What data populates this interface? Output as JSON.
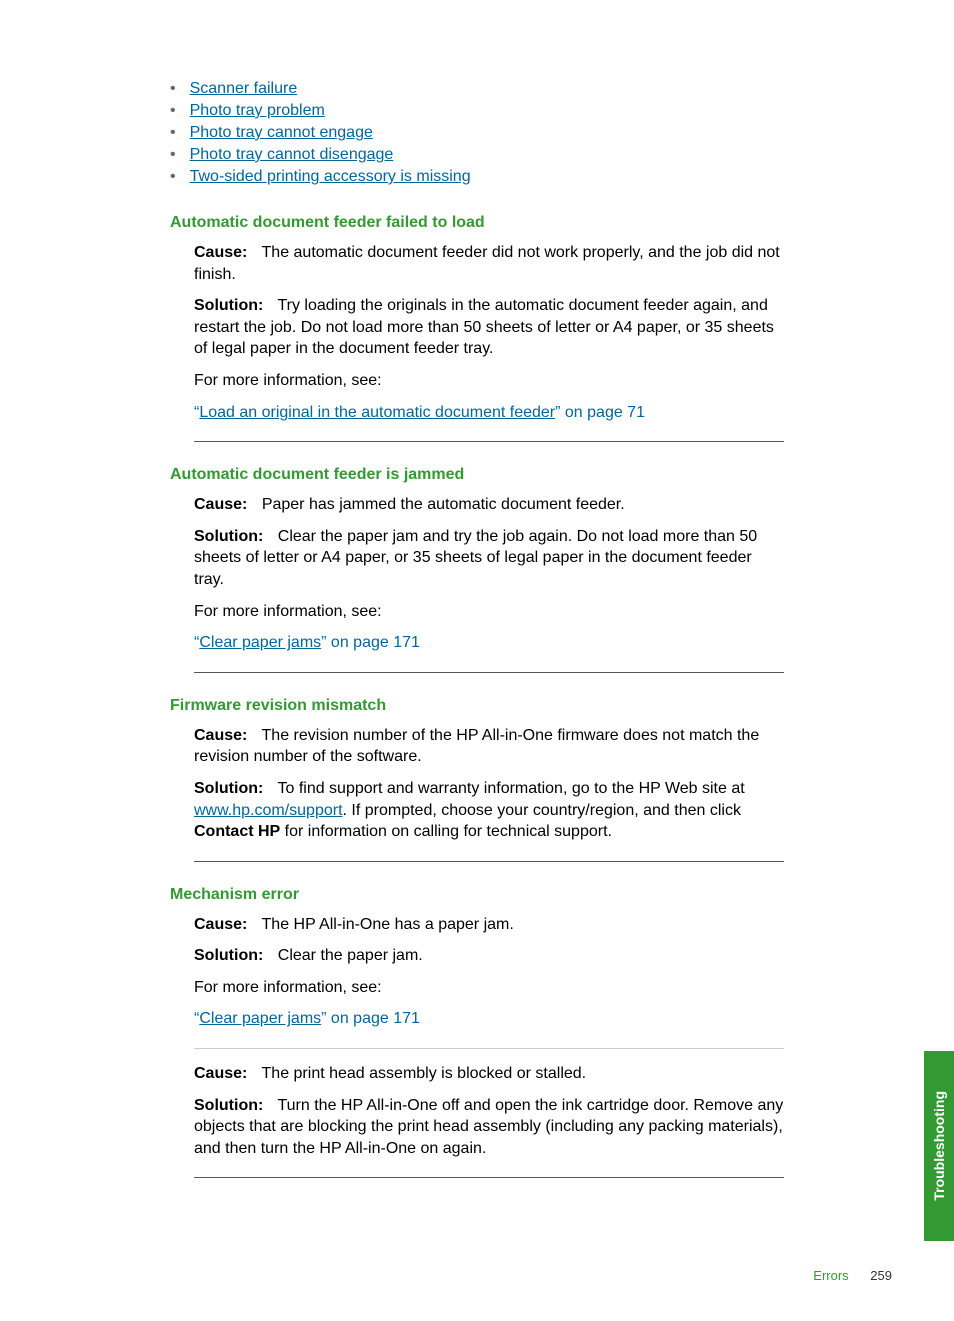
{
  "toc": [
    "Scanner failure",
    "Photo tray problem",
    "Photo tray cannot engage",
    "Photo tray cannot disengage",
    "Two-sided printing accessory is missing"
  ],
  "sections": {
    "s1": {
      "heading": "Automatic document feeder failed to load",
      "cause_label": "Cause:",
      "cause_text": "The automatic document feeder did not work properly, and the job did not finish.",
      "solution_label": "Solution:",
      "solution_text": "Try loading the originals in the automatic document feeder again, and restart the job. Do not load more than 50 sheets of letter or A4 paper, or 35 sheets of legal paper in the document feeder tray.",
      "more_info": "For more information, see:",
      "link_prefix": "“",
      "link_text": "Load an original in the automatic document feeder",
      "link_suffix": "” on page 71"
    },
    "s2": {
      "heading": "Automatic document feeder is jammed",
      "cause_label": "Cause:",
      "cause_text": "Paper has jammed the automatic document feeder.",
      "solution_label": "Solution:",
      "solution_text": "Clear the paper jam and try the job again. Do not load more than 50 sheets of letter or A4 paper, or 35 sheets of legal paper in the document feeder tray.",
      "more_info": "For more information, see:",
      "link_prefix": "“",
      "link_text": "Clear paper jams",
      "link_suffix": "” on page 171"
    },
    "s3": {
      "heading": "Firmware revision mismatch",
      "cause_label": "Cause:",
      "cause_text": "The revision number of the HP All-in-One firmware does not match the revision number of the software.",
      "solution_label": "Solution:",
      "solution_text_a": "To find support and warranty information, go to the HP Web site at ",
      "support_link": "www.hp.com/support",
      "solution_text_b": ". If prompted, choose your country/region, and then click ",
      "bold_text": "Contact HP",
      "solution_text_c": " for information on calling for technical support."
    },
    "s4": {
      "heading": "Mechanism error",
      "block1": {
        "cause_label": "Cause:",
        "cause_text": "The HP All-in-One has a paper jam.",
        "solution_label": "Solution:",
        "solution_text": "Clear the paper jam.",
        "more_info": "For more information, see:",
        "link_prefix": "“",
        "link_text": "Clear paper jams",
        "link_suffix": "” on page 171"
      },
      "block2": {
        "cause_label": "Cause:",
        "cause_text": "The print head assembly is blocked or stalled.",
        "solution_label": "Solution:",
        "solution_text": "Turn the HP All-in-One off and open the ink cartridge door. Remove any objects that are blocking the print head assembly (including any packing materials), and then turn the HP All-in-One on again."
      }
    }
  },
  "side_tab": "Troubleshooting",
  "footer": {
    "label": "Errors",
    "page": "259"
  }
}
